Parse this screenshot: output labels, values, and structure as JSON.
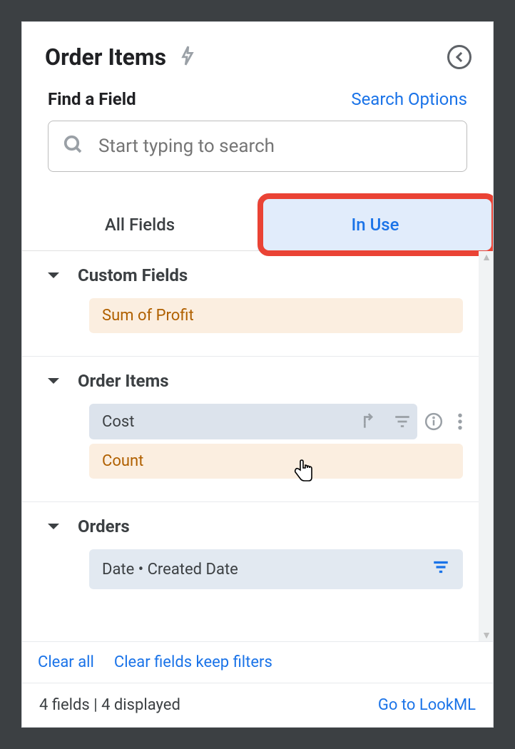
{
  "header": {
    "title": "Order Items"
  },
  "search": {
    "find_label": "Find a Field",
    "options_label": "Search Options",
    "placeholder": "Start typing to search"
  },
  "tabs": {
    "all": "All Fields",
    "in_use": "In Use"
  },
  "sections": [
    {
      "title": "Custom Fields",
      "fields": [
        {
          "label": "Sum of Profit",
          "variant": "orange"
        }
      ]
    },
    {
      "title": "Order Items",
      "fields": [
        {
          "label": "Cost",
          "variant": "blue-hover"
        },
        {
          "label": "Count",
          "variant": "orange"
        }
      ]
    },
    {
      "title": "Orders",
      "fields": [
        {
          "label": "Date • Created Date",
          "variant": "blue",
          "filter": true
        }
      ]
    }
  ],
  "footer": {
    "clear_all": "Clear all",
    "clear_keep": "Clear fields keep filters"
  },
  "status": {
    "text": "4 fields | 4 displayed",
    "goto": "Go to LookML"
  }
}
